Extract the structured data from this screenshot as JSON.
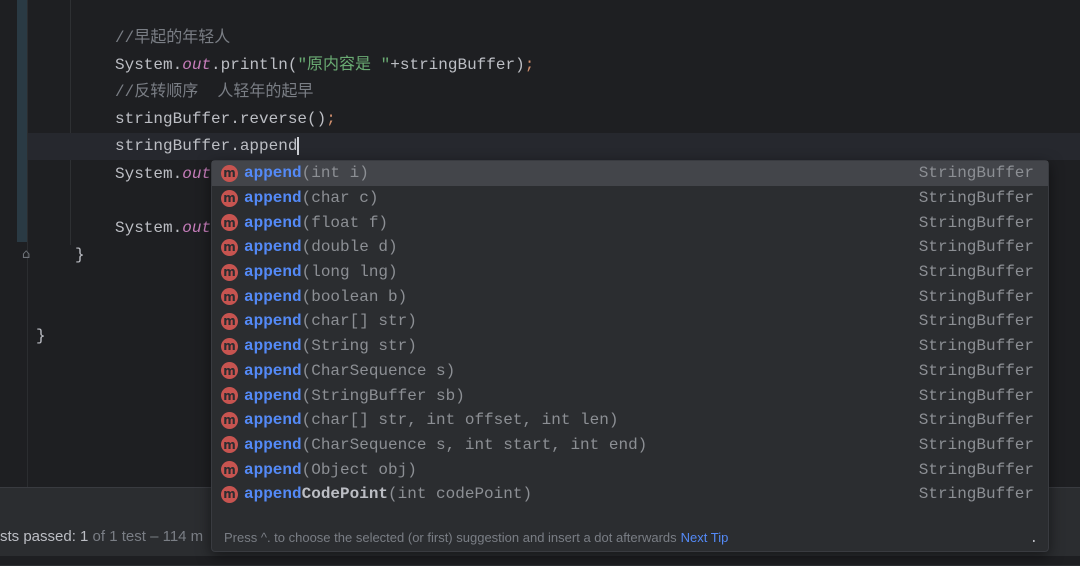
{
  "code": {
    "comment1": "//早起的年轻人",
    "line2_prefix": "System.",
    "line2_out": "out",
    "line2_mid": ".println(",
    "line2_str": "\"原内容是 \"",
    "line2_rest": "+stringBuffer)",
    "semicolon": ";",
    "comment2": "//反转顺序  人轻年的起早",
    "line4": "stringBuffer.reverse()",
    "line5": "stringBuffer.append",
    "line6_prefix": "System.",
    "line6_out": "out",
    "brace": "}"
  },
  "completion": {
    "items": [
      {
        "name": "append",
        "params": "(int i)",
        "type": "StringBuffer"
      },
      {
        "name": "append",
        "params": "(char c)",
        "type": "StringBuffer"
      },
      {
        "name": "append",
        "params": "(float f)",
        "type": "StringBuffer"
      },
      {
        "name": "append",
        "params": "(double d)",
        "type": "StringBuffer"
      },
      {
        "name": "append",
        "params": "(long lng)",
        "type": "StringBuffer"
      },
      {
        "name": "append",
        "params": "(boolean b)",
        "type": "StringBuffer"
      },
      {
        "name": "append",
        "params": "(char[] str)",
        "type": "StringBuffer"
      },
      {
        "name": "append",
        "params": "(String str)",
        "type": "StringBuffer"
      },
      {
        "name": "append",
        "params": "(CharSequence s)",
        "type": "StringBuffer"
      },
      {
        "name": "append",
        "params": "(StringBuffer sb)",
        "type": "StringBuffer"
      },
      {
        "name": "append",
        "params": "(char[] str, int offset, int len)",
        "type": "StringBuffer"
      },
      {
        "name": "append",
        "params": "(CharSequence s, int start, int end)",
        "type": "StringBuffer"
      },
      {
        "name": "append",
        "params": "(Object obj)",
        "type": "StringBuffer"
      },
      {
        "name": "append",
        "name_suffix": "CodePoint",
        "params": "(int codePoint)",
        "type": "StringBuffer"
      }
    ],
    "icon_letter": "m",
    "tip": "Press ^. to choose the selected (or first) suggestion and insert a dot afterwards",
    "next_tip": "Next Tip",
    "menu_dot": "."
  },
  "test_status": {
    "label": "sts passed: 1",
    "detail": " of 1 test – 114 m"
  }
}
